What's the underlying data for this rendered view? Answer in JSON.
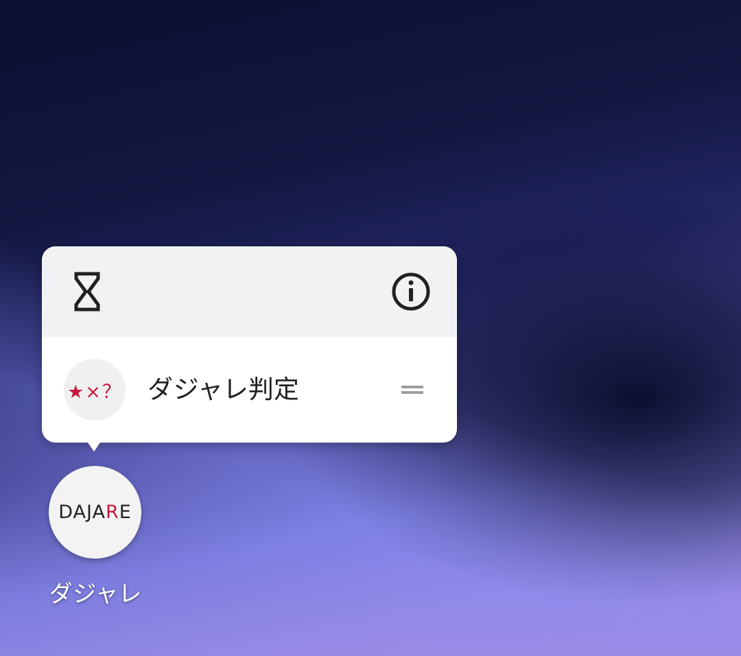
{
  "popup": {
    "header": {
      "left_icon": "hourglass-icon",
      "right_icon": "info-icon"
    },
    "shortcut": {
      "icon_text": "★×？",
      "label": "ダジャレ判定",
      "handle_icon": "drag-handle-icon"
    }
  },
  "app": {
    "logo_text_pre": "DAJA",
    "logo_text_accent": "R",
    "logo_text_post": "E",
    "name": "ダジャレ"
  },
  "colors": {
    "accent_red": "#c4183c",
    "popup_header_bg": "#f1f2f4",
    "popup_bg": "#ffffff"
  }
}
